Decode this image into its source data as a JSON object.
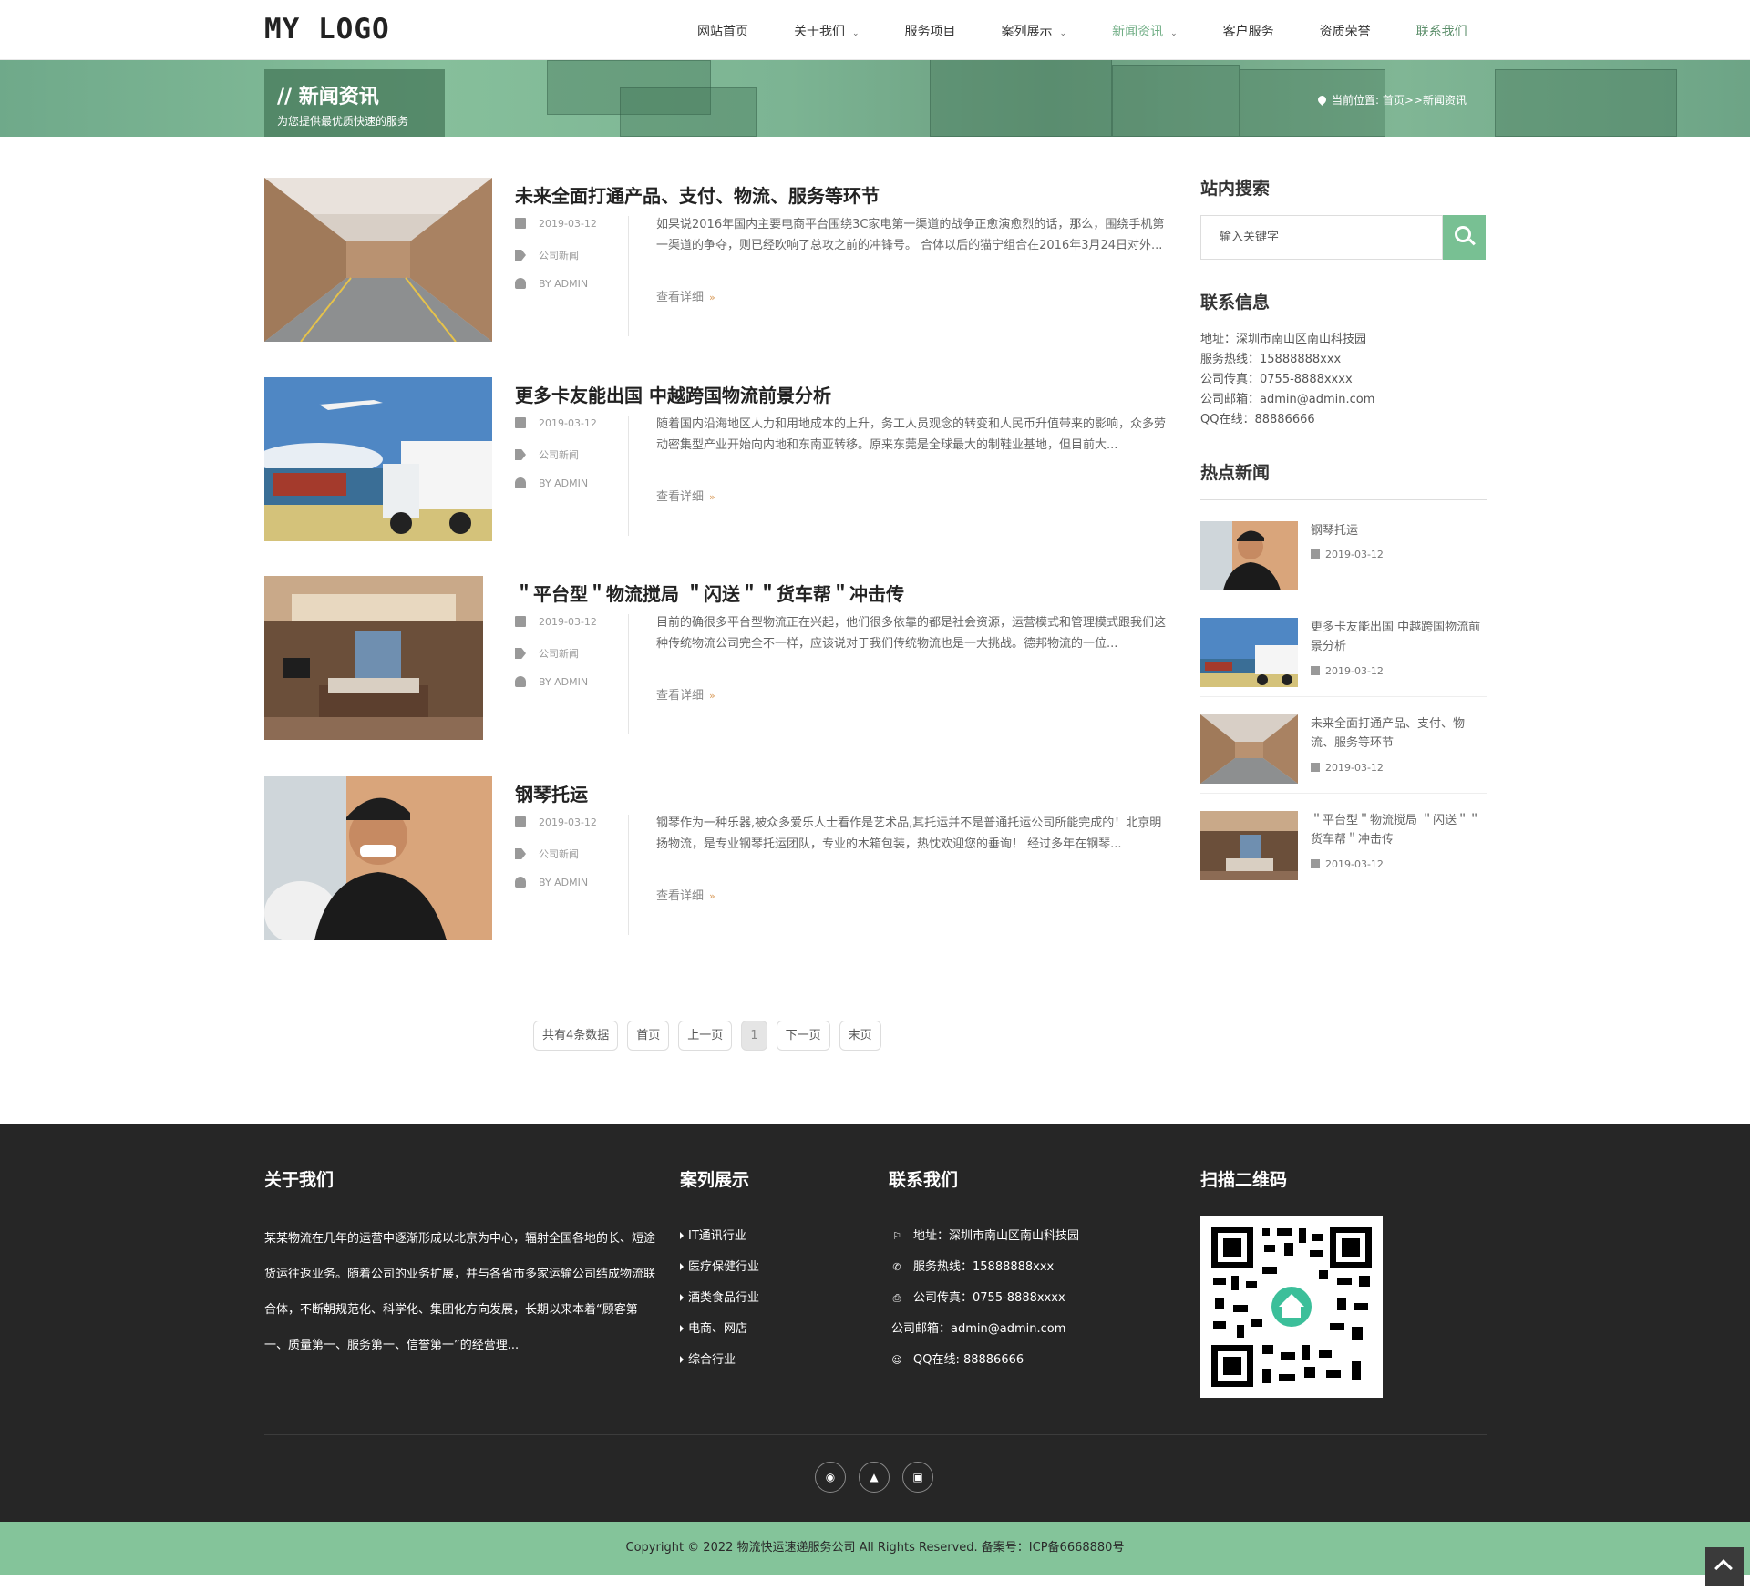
{
  "header": {
    "logo": "MY LOGO",
    "nav": [
      {
        "label": "网站首页",
        "dropdown": false
      },
      {
        "label": "关于我们",
        "dropdown": true
      },
      {
        "label": "服务项目",
        "dropdown": false
      },
      {
        "label": "案列展示",
        "dropdown": true
      },
      {
        "label": "新闻资讯",
        "dropdown": true,
        "active": true
      },
      {
        "label": "客户服务",
        "dropdown": false
      },
      {
        "label": "资质荣誉",
        "dropdown": false
      },
      {
        "label": "联系我们",
        "dropdown": false
      }
    ]
  },
  "banner": {
    "title": "// 新闻资讯",
    "subtitle": "为您提供最优质快速的服务",
    "breadcrumb": "当前位置: 首页>>新闻资讯"
  },
  "articles": [
    {
      "title": "未来全面打通产品、支付、物流、服务等环节",
      "date": "2019-03-12",
      "category": "公司新闻",
      "author": "BY ADMIN",
      "excerpt": "如果说2016年国内主要电商平台围绕3C家电第一渠道的战争正愈演愈烈的话，那么，围绕手机第一渠道的争夺，则已经吹响了总攻之前的冲锋号。 合体以后的猫宁组合在2016年3月24日对外...",
      "more": "查看详细"
    },
    {
      "title": "更多卡友能出国 中越跨国物流前景分析",
      "date": "2019-03-12",
      "category": "公司新闻",
      "author": "BY ADMIN",
      "excerpt": "随着国内沿海地区人力和用地成本的上升，务工人员观念的转变和人民币升值带来的影响，众多劳动密集型产业开始向内地和东南亚转移。原来东莞是全球最大的制鞋业基地，但目前大...",
      "more": "查看详细"
    },
    {
      "title": "＂平台型＂物流搅局 ＂闪送＂＂货车帮＂冲击传",
      "date": "2019-03-12",
      "category": "公司新闻",
      "author": "BY ADMIN",
      "excerpt": "目前的确很多平台型物流正在兴起，他们很多依靠的都是社会资源，运营模式和管理模式跟我们这种传统物流公司完全不一样，应该说对于我们传统物流也是一大挑战。德邦物流的一位...",
      "more": "查看详细"
    },
    {
      "title": "钢琴托运",
      "date": "2019-03-12",
      "category": "公司新闻",
      "author": "BY ADMIN",
      "excerpt": "钢琴作为一种乐器,被众多爱乐人士看作是艺术品,其托运并不是普通托运公司所能完成的！北京明扬物流，是专业钢琴托运团队，专业的木箱包装，热忱欢迎您的垂询！ 经过多年在钢琴...",
      "more": "查看详细"
    }
  ],
  "pagination": {
    "total": "共有4条数据",
    "first": "首页",
    "prev": "上一页",
    "current": "1",
    "next": "下一页",
    "last": "末页"
  },
  "sidebar": {
    "search_title": "站内搜索",
    "search_placeholder": "输入关键字",
    "contact_title": "联系信息",
    "contact": [
      "地址：深圳市南山区南山科技园",
      "服务热线：15888888xxx",
      "公司传真：0755-8888xxxx",
      "公司邮箱：admin@admin.com",
      "QQ在线：88886666"
    ],
    "hot_title": "热点新闻",
    "hot": [
      {
        "title": "钢琴托运",
        "date": "2019-03-12"
      },
      {
        "title": "更多卡友能出国 中越跨国物流前景分析",
        "date": "2019-03-12"
      },
      {
        "title": "未来全面打通产品、支付、物流、服务等环节",
        "date": "2019-03-12"
      },
      {
        "title": "＂平台型＂物流搅局 ＂闪送＂＂货车帮＂冲击传",
        "date": "2019-03-12"
      }
    ]
  },
  "footer": {
    "about_title": "关于我们",
    "about_text": "某某物流在几年的运营中逐渐形成以北京为中心，辐射全国各地的长、短途货运往返业务。随着公司的业务扩展，并与各省市多家运输公司结成物流联合体，不断朝规范化、科学化、集团化方向发展，长期以来本着“顾客第一、质量第一、服务第一、信誉第一”的经营理...",
    "cases_title": "案列展示",
    "cases": [
      "IT通讯行业",
      "医疗保健行业",
      "酒类食品行业",
      "电商、网店",
      "综合行业"
    ],
    "contact_title": "联系我们",
    "contact": [
      "地址：深圳市南山区南山科技园",
      "服务热线：15888888xxx",
      "公司传真：0755-8888xxxx",
      "公司邮箱：admin@admin.com",
      "QQ在线: 88886666"
    ],
    "qr_title": "扫描二维码",
    "copyright": "Copyright © 2022 物流快运速递服务公司 All Rights Reserved. 备案号：ICP备6668880号"
  },
  "colors": {
    "accent": "#78c093",
    "footer_bg": "#262626",
    "copyright_bg": "#84c49a"
  }
}
